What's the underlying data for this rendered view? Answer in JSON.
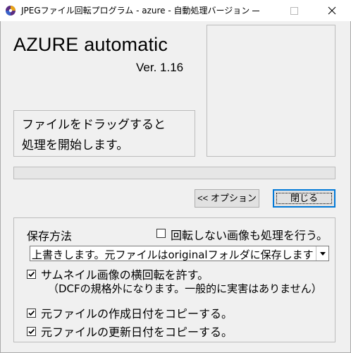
{
  "window": {
    "title": "JPEGファイル回転プログラム - azure - 自動処理バージョン"
  },
  "header": {
    "app_name": "AZURE automatic",
    "version": "Ver. 1.16"
  },
  "drop_area": {
    "line1": "ファイルをドラッグすると",
    "line2": "処理を開始します。"
  },
  "progress": {
    "value": 0
  },
  "buttons": {
    "options": "<< オプション",
    "close": "閉じる"
  },
  "options": {
    "save_method_label": "保存方法",
    "no_rotate_label": "回転しない画像も処理を行う。",
    "no_rotate_checked": false,
    "save_method_selected": "上書きします。元ファイルはoriginalフォルダに保存します",
    "thumb_rotate_label": "サムネイル画像の横回転を許す。",
    "thumb_rotate_checked": true,
    "dcf_note": "（DCFの規格外になります。一般的に実害はありません）",
    "copy_created_label": "元ファイルの作成日付をコピーする。",
    "copy_created_checked": true,
    "copy_updated_label": "元ファイルの更新日付をコピーする。",
    "copy_updated_checked": true
  }
}
